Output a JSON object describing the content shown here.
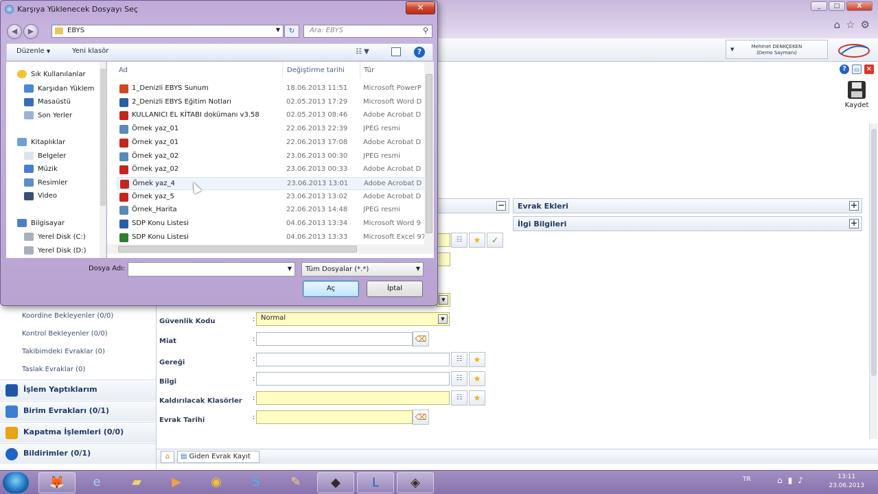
{
  "browser": {
    "window_controls": [
      "_",
      "□",
      "X"
    ]
  },
  "app": {
    "user_name": "Mehmet DENKÇEKEN",
    "user_role": "(Demo Saymanı)",
    "save_label": "Kaydet",
    "left_nav": {
      "sub_items": [
        "Koordine Bekleyenler (0/0)",
        "Kontrol Bekleyenler (0/0)",
        "Takibimdeki Evraklar (0)",
        "Taslak Evraklar (0)"
      ],
      "main_items": [
        "İşlem Yaptıklarım",
        "Birim Evrakları (0/1)",
        "Kapatma İşlemleri (0/0)",
        "Bildirimler (0/1)"
      ]
    },
    "panels": {
      "evrak_ekleri": "Evrak Ekleri",
      "ilgi_bilgileri": "İlgi Bilgileri"
    },
    "form": {
      "guvenlik_kodu_label": "Güvenlik Kodu",
      "guvenlik_kodu_value": "Normal",
      "miat_label": "Miat",
      "geregi_label": "Gereği",
      "bilgi_label": "Bilgi",
      "kaldirilacak_label": "Kaldırılacak Klasörler",
      "evrak_tarihi_label": "Evrak Tarihi",
      "colon": ":"
    },
    "bottom_tab": "Giden Evrak Kayıt"
  },
  "dialog": {
    "title": "Karşıya Yüklenecek Dosyayı Seç",
    "address": "EBYS",
    "search_placeholder": "Ara: EBYS",
    "toolbar": {
      "organize": "Düzenle",
      "new_folder": "Yeni klasör"
    },
    "nav_pane": {
      "favorites_header": "Sık Kullanılanlar",
      "favorites": [
        "Karşıdan Yüklem",
        "Masaüstü",
        "Son Yerler"
      ],
      "libraries_header": "Kitaplıklar",
      "libraries": [
        "Belgeler",
        "Müzik",
        "Resimler",
        "Video"
      ],
      "computer_header": "Bilgisayar",
      "drives": [
        "Yerel Disk (C:)",
        "Yerel Disk (D:)"
      ]
    },
    "columns": {
      "name": "Ad",
      "modified": "Değiştirme tarihi",
      "type": "Tür"
    },
    "files": [
      {
        "name": "1_Denizli EBYS Sunum",
        "modified": "18.06.2013 11:51",
        "type": "Microsoft PowerP",
        "icon": "ppt-icon"
      },
      {
        "name": "2_Denizli EBYS Eğitim Notları",
        "modified": "02.05.2013 17:29",
        "type": "Microsoft Word D",
        "icon": "word-icon"
      },
      {
        "name": "KULLANICI EL KİTABI dokümanı v3.58",
        "modified": "02.05.2013 08:46",
        "type": "Adobe Acrobat D",
        "icon": "pdf-icon"
      },
      {
        "name": "Örnek yaz_01",
        "modified": "22.06.2013 22:39",
        "type": "JPEG resmi",
        "icon": "image-icon"
      },
      {
        "name": "Örnek yaz_01",
        "modified": "22.06.2013 17:08",
        "type": "Adobe Acrobat D",
        "icon": "pdf-icon"
      },
      {
        "name": "Örnek yaz_02",
        "modified": "23.06.2013 00:30",
        "type": "JPEG resmi",
        "icon": "image-icon"
      },
      {
        "name": "Örnek yaz_02",
        "modified": "23.06.2013 00:33",
        "type": "Adobe Acrobat D",
        "icon": "pdf-icon"
      },
      {
        "name": "Örnek yaz_4",
        "modified": "23.06.2013 13:01",
        "type": "Adobe Acrobat D",
        "icon": "pdf-icon"
      },
      {
        "name": "Örnek yaz_5",
        "modified": "23.06.2013 13:02",
        "type": "Adobe Acrobat D",
        "icon": "pdf-icon"
      },
      {
        "name": "Örnek_Harita",
        "modified": "22.06.2013 14:48",
        "type": "JPEG resmi",
        "icon": "image-icon"
      },
      {
        "name": "SDP Konu Listesi",
        "modified": "04.06.2013 13:34",
        "type": "Microsoft Word 9",
        "icon": "word-icon"
      },
      {
        "name": "SDP Konu Listesi",
        "modified": "04.06.2013 13:33",
        "type": "Microsoft Excel 97",
        "icon": "excel-icon"
      }
    ],
    "filename_label": "Dosya Adı:",
    "filename_value": "",
    "filetype_value": "Tüm Dosyalar (*.*)",
    "open_label": "Aç",
    "cancel_label": "İptal"
  },
  "taskbar": {
    "language": "TR",
    "time": "13:11",
    "date": "23.06.2013"
  },
  "colors": {
    "accent": "#1f63c6",
    "field_highlight": "#fffdc4",
    "close_red": "#d0452d"
  }
}
